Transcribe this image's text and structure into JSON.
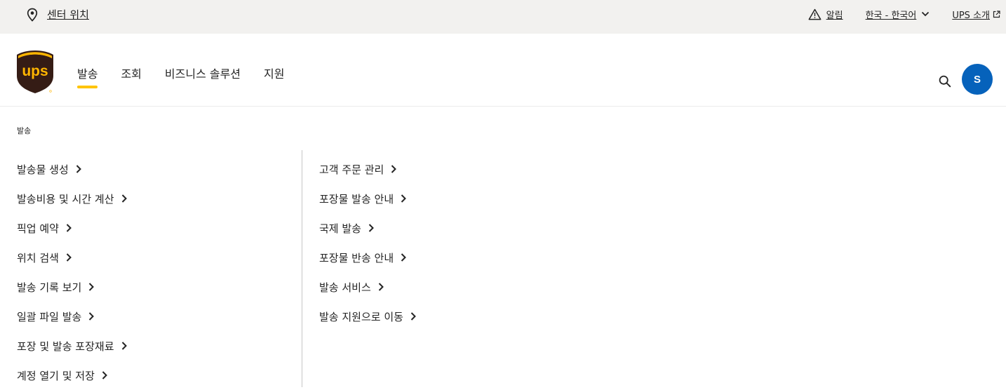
{
  "utility": {
    "location_label": "센터 위치",
    "alerts_label": "알림",
    "language_label": "한국 - 한국어",
    "about_label": "UPS 소개"
  },
  "header": {
    "logo_text": "ups",
    "nav": [
      {
        "label": "발송",
        "active": true
      },
      {
        "label": "조회",
        "active": false
      },
      {
        "label": "비즈니스 솔루션",
        "active": false
      },
      {
        "label": "지원",
        "active": false
      }
    ],
    "avatar_initial": "S"
  },
  "menu": {
    "title": "발송",
    "left_links": [
      "발송물 생성",
      "발송비용 및 시간 계산",
      "픽업 예약",
      "위치 검색",
      "발송 기록 보기",
      "일괄 파일 발송",
      "포장 및 발송 포장재료",
      "계정 열기 및 저장"
    ],
    "right_links": [
      "고객 주문 관리",
      "포장물 발송 안내",
      "국제 발송",
      "포장물 반송 안내",
      "발송 서비스",
      "발송 지원으로 이동"
    ]
  },
  "colors": {
    "utility_bg": "#f2f1ef",
    "brand_brown": "#351c15",
    "brand_gold": "#ffb500",
    "nav_underline": "#ffc400",
    "avatar_blue": "#0662bb"
  }
}
